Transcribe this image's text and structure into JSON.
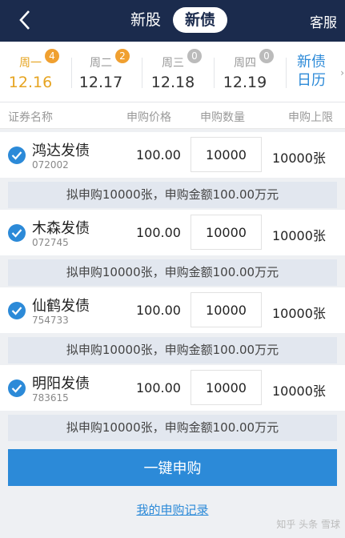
{
  "header": {
    "tabs": [
      {
        "label": "新股",
        "active": false
      },
      {
        "label": "新债",
        "active": true
      }
    ],
    "service_label": "客服"
  },
  "days": [
    {
      "weekday": "周一",
      "date": "12.16",
      "count": "4",
      "active": true
    },
    {
      "weekday": "周二",
      "date": "12.17",
      "count": "2",
      "active": false
    },
    {
      "weekday": "周三",
      "date": "12.18",
      "count": "0",
      "active": false
    },
    {
      "weekday": "周四",
      "date": "12.19",
      "count": "0",
      "active": false
    }
  ],
  "calendar_label": "新债日历",
  "columns": [
    "证券名称",
    "申购价格",
    "申购数量",
    "申购上限"
  ],
  "bonds": [
    {
      "name": "鸿达发债",
      "code": "072002",
      "price": "100.00",
      "quantity": "10000",
      "limit": "10000张",
      "summary": "拟申购10000张，申购金额100.00万元"
    },
    {
      "name": "木森发债",
      "code": "072745",
      "price": "100.00",
      "quantity": "10000",
      "limit": "10000张",
      "summary": "拟申购10000张，申购金额100.00万元"
    },
    {
      "name": "仙鹤发债",
      "code": "754733",
      "price": "100.00",
      "quantity": "10000",
      "limit": "10000张",
      "summary": "拟申购10000张，申购金额100.00万元"
    },
    {
      "name": "明阳发债",
      "code": "783615",
      "price": "100.00",
      "quantity": "10000",
      "limit": "10000张",
      "summary": "拟申购10000张，申购金额100.00万元"
    }
  ],
  "submit_label": "一键申购",
  "records_label": "我的申购记录",
  "watermark": "知乎 头条 雪球",
  "colors": {
    "header_bg": "#1b2b4d",
    "accent": "#2c8ad8",
    "active_day": "#e6a421",
    "badge": "#f0a030"
  }
}
